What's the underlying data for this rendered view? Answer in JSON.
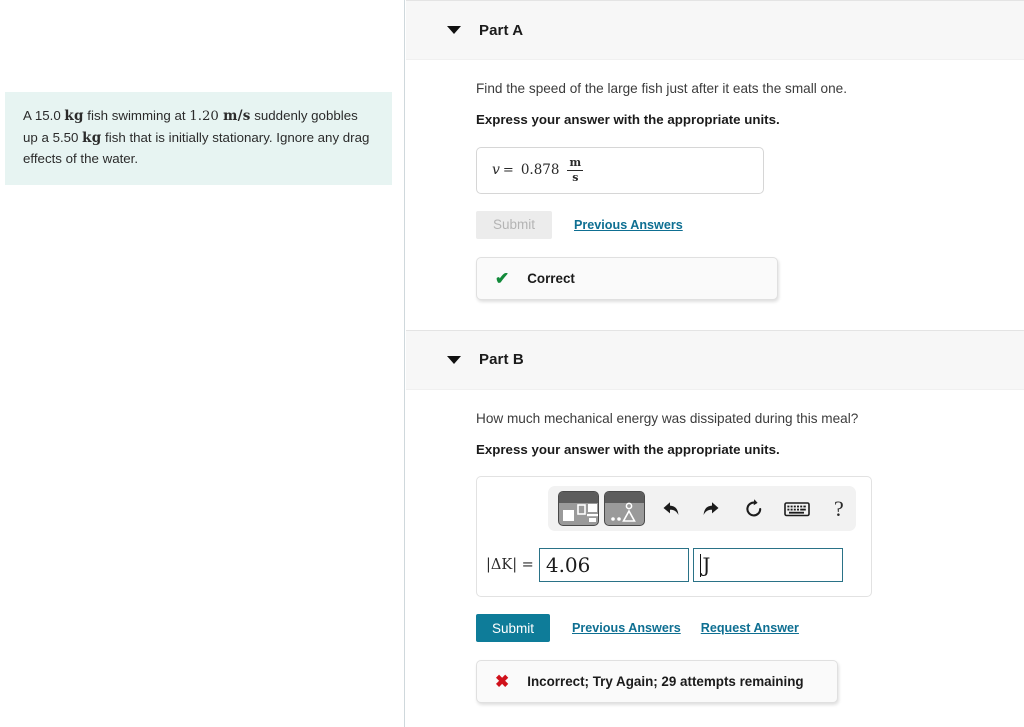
{
  "problem": {
    "segments": [
      {
        "type": "text",
        "value": "A 15.0 "
      },
      {
        "type": "unit",
        "value": "kg"
      },
      {
        "type": "text",
        "value": " fish swimming at "
      },
      {
        "type": "num",
        "value": "1.20 "
      },
      {
        "type": "unit",
        "value": "m/s"
      },
      {
        "type": "text",
        "value": " suddenly gobbles up a 5.50 "
      },
      {
        "type": "unit",
        "value": "kg"
      },
      {
        "type": "text",
        "value": " fish that is initially stationary. Ignore any drag effects of the water."
      }
    ],
    "full_text": "A 15.0 kg fish swimming at 1.20 m/s suddenly gobbles up a 5.50 kg fish that is initially stationary. Ignore any drag effects of the water.",
    "background_color": "#e7f4f2"
  },
  "part_a": {
    "title": "Part A",
    "question": "Find the speed of the large fish just after it eats the small one.",
    "instruction": "Express your answer with the appropriate units.",
    "answer": {
      "variable": "v",
      "equals": "=",
      "value": "0.878",
      "unit_numerator": "m",
      "unit_denominator": "s"
    },
    "submit_label": "Submit",
    "submit_enabled": false,
    "previous_answers_label": "Previous Answers",
    "feedback": {
      "icon": "check-icon",
      "text": "Correct",
      "color": "#128a3a"
    }
  },
  "part_b": {
    "title": "Part B",
    "question": "How much mechanical energy was dissipated during this meal?",
    "instruction": "Express your answer with the appropriate units.",
    "toolbar": {
      "buttons": [
        {
          "name": "math-templates-palette",
          "label": ""
        },
        {
          "name": "symbols-palette",
          "label": ""
        },
        {
          "name": "undo",
          "label": ""
        },
        {
          "name": "redo",
          "label": ""
        },
        {
          "name": "reset",
          "label": ""
        },
        {
          "name": "keyboard",
          "label": ""
        },
        {
          "name": "help",
          "label": "?"
        }
      ],
      "help_glyph": "?"
    },
    "answer": {
      "label": "|ΔK| =",
      "value": "4.06",
      "units": "J"
    },
    "submit_label": "Submit",
    "submit_enabled": true,
    "previous_answers_label": "Previous Answers",
    "request_answer_label": "Request Answer",
    "feedback": {
      "icon": "cross-icon",
      "text": "Incorrect; Try Again; 29 attempts remaining",
      "color": "#d0111b"
    }
  },
  "theme": {
    "accent": "#0e7c99",
    "link": "#0e6f92",
    "header_bg": "#f7f7f7",
    "correct": "#128a3a",
    "incorrect": "#d0111b"
  }
}
